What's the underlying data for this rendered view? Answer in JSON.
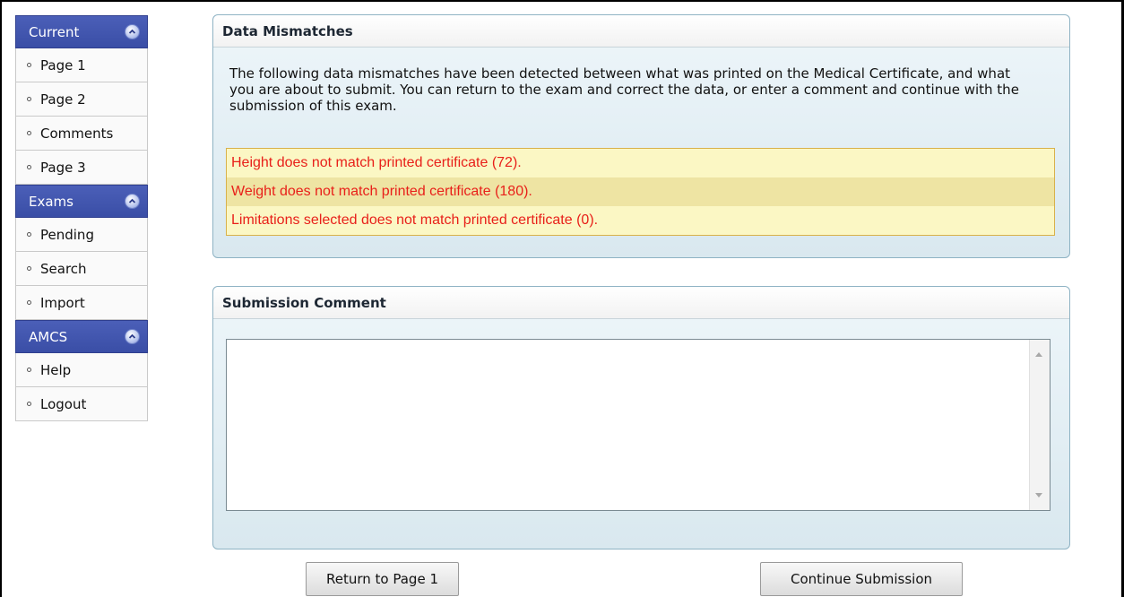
{
  "sidebar": {
    "sections": [
      {
        "title": "Current",
        "items": [
          "Page 1",
          "Page 2",
          "Comments",
          "Page 3"
        ]
      },
      {
        "title": "Exams",
        "items": [
          "Pending",
          "Search",
          "Import"
        ]
      },
      {
        "title": "AMCS",
        "items": [
          "Help",
          "Logout"
        ]
      }
    ]
  },
  "mismatches": {
    "title": "Data Mismatches",
    "intro": "The following data mismatches have been detected between what was printed on the Medical Certificate, and what you are about to submit. You can return to the exam and correct the data, or enter a comment and continue with the submission of this exam.",
    "items": [
      "Height does not match printed certificate (72).",
      "Weight does not match printed certificate (180).",
      "Limitations selected does not match printed certificate (0)."
    ]
  },
  "comment": {
    "title": "Submission Comment",
    "value": ""
  },
  "buttons": {
    "return_label": "Return to Page 1",
    "continue_label": "Continue Submission"
  },
  "colors": {
    "sidebar_header": "#3f53ab",
    "error_text": "#e8201a",
    "row_light": "#fbf7c4",
    "row_dark": "#eee4a3"
  }
}
